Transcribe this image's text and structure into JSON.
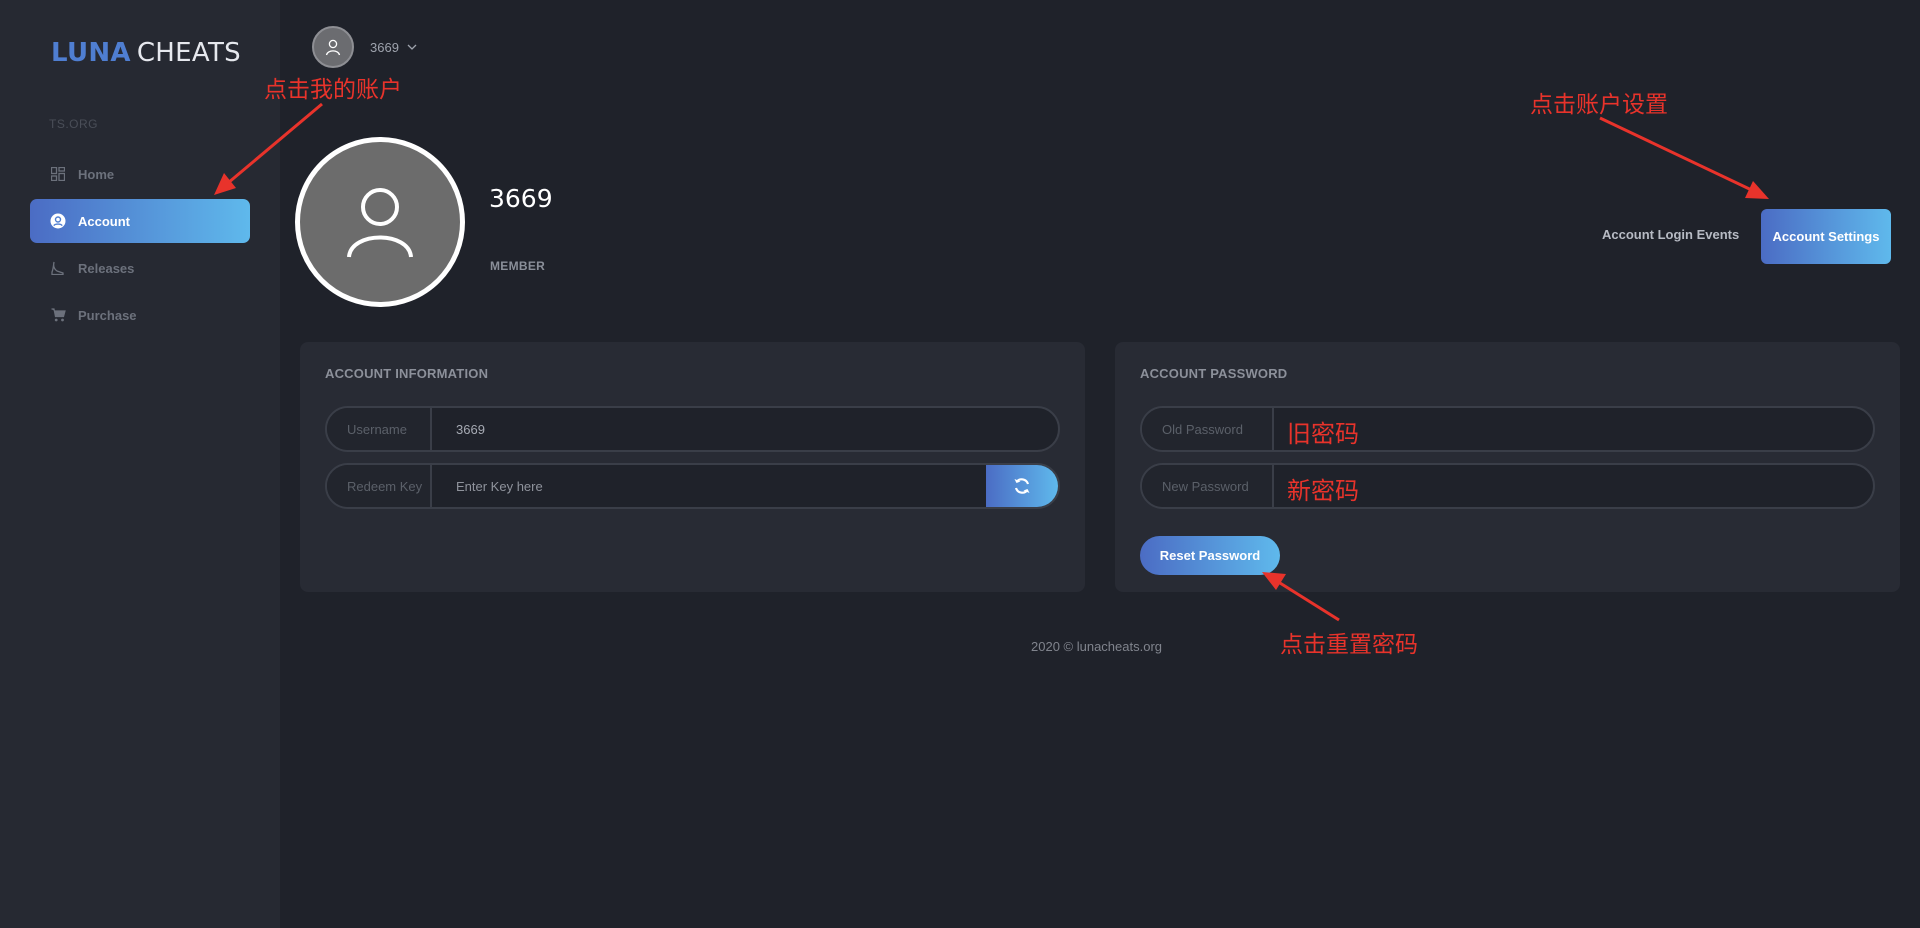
{
  "brand": {
    "logo_part1": "LUNA",
    "logo_part2": "CHEATS",
    "site_label": "TS.ORG",
    "accent": "#4f7ed1"
  },
  "sidebar": {
    "items": [
      {
        "label": "Home",
        "icon": "dashboard-icon",
        "active": false
      },
      {
        "label": "Account",
        "icon": "user-circle-icon",
        "active": true
      },
      {
        "label": "Releases",
        "icon": "releases-icon",
        "active": false
      },
      {
        "label": "Purchase",
        "icon": "cart-icon",
        "active": false
      }
    ]
  },
  "topbar": {
    "username": "3669"
  },
  "profile": {
    "name": "3669",
    "role": "MEMBER",
    "login_events_label": "Account Login Events",
    "settings_label": "Account Settings"
  },
  "account_info": {
    "title": "ACCOUNT INFORMATION",
    "username_label": "Username",
    "username_value": "3669",
    "redeem_label": "Redeem Key",
    "redeem_placeholder": "Enter Key here"
  },
  "account_password": {
    "title": "ACCOUNT PASSWORD",
    "old_label": "Old Password",
    "old_overlay": "旧密码",
    "new_label": "New Password",
    "new_overlay": "新密码",
    "reset_label": "Reset Password"
  },
  "footer": {
    "text": "2020 © lunacheats.org"
  },
  "annotations": {
    "click_account": "点击我的账户",
    "click_settings": "点击账户设置",
    "click_reset": "点击重置密码",
    "color": "#e8332b"
  }
}
